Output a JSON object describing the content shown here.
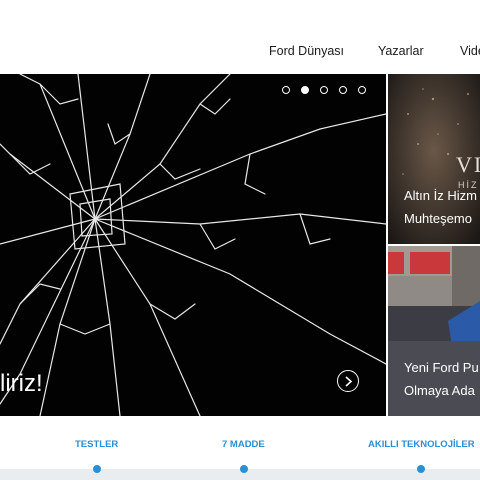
{
  "nav": {
    "items": [
      "Ford Dünyası",
      "Yazarlar",
      "Vide"
    ]
  },
  "hero": {
    "caption": "liriz!",
    "slides_total": 5,
    "slide_active": 2
  },
  "side_cards": [
    {
      "line1": "Altın İz Hizm",
      "line2": "Muhteşemo",
      "logo": "VI",
      "logo_sub": "HİZ"
    },
    {
      "line1": "Yeni Ford Pu",
      "line2": "Olmaya Ada"
    }
  ],
  "tabs": [
    "TESTLER",
    "7 MADDE",
    "AKILLI TEKNOLOJİLER"
  ],
  "colors": {
    "accent": "#2c8fd1",
    "hero_bg": "#020202"
  },
  "icons": {
    "next": "chevron-right-icon"
  }
}
